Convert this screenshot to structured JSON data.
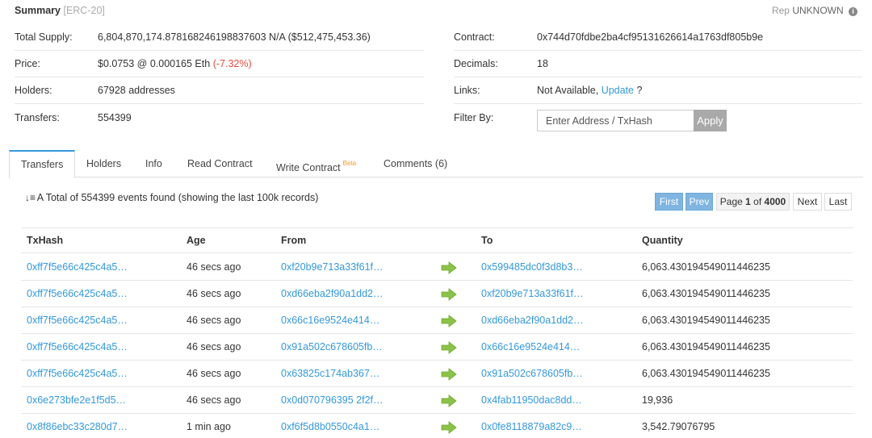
{
  "summary": {
    "title": "Summary",
    "tag": "[ERC-20]",
    "rep_label": "Rep",
    "rep_value": "UNKNOWN",
    "total_supply_label": "Total Supply:",
    "total_supply_value": "6,804,870,174.878168246198837603 N/A ($512,475,453.36)",
    "price_label": "Price:",
    "price_value": "$0.0753 @ 0.000165 Eth",
    "price_change": "(-7.32%)",
    "holders_label": "Holders:",
    "holders_value": "67928 addresses",
    "transfers_label": "Transfers:",
    "transfers_value": "554399",
    "contract_label": "Contract:",
    "contract_value": "0x744d70fdbe2ba4cf95131626614a1763df805b9e",
    "decimals_label": "Decimals:",
    "decimals_value": "18",
    "links_label": "Links:",
    "links_value": "Not Available,",
    "links_update": "Update",
    "links_q": "?",
    "filter_label": "Filter By:",
    "filter_placeholder": "Enter Address / TxHash",
    "apply_label": "Apply"
  },
  "tabs": [
    {
      "label": "Transfers",
      "active": true
    },
    {
      "label": "Holders"
    },
    {
      "label": "Info"
    },
    {
      "label": "Read Contract"
    },
    {
      "label": "Write Contract",
      "badge": "Beta"
    },
    {
      "label": "Comments (6)"
    }
  ],
  "events_text": "A Total of 554399 events found (showing the last 100k records)",
  "pagination": {
    "first": "First",
    "prev": "Prev",
    "page_prefix": "Page",
    "page_current": "1",
    "page_of": "of",
    "page_total": "4000",
    "next": "Next",
    "last": "Last"
  },
  "table": {
    "columns": [
      "TxHash",
      "Age",
      "From",
      "To",
      "Quantity"
    ],
    "rows": [
      {
        "hash": "0xff7f5e66c425c4a5…",
        "age": "46 secs ago",
        "from": "0xf20b9e713a33f61f…",
        "to": "0x599485dc0f3d8b3…",
        "qty": "6,063.430194549011446235"
      },
      {
        "hash": "0xff7f5e66c425c4a5…",
        "age": "46 secs ago",
        "from": "0xd66eba2f90a1dd2…",
        "to": "0xf20b9e713a33f61f…",
        "qty": "6,063.430194549011446235"
      },
      {
        "hash": "0xff7f5e66c425c4a5…",
        "age": "46 secs ago",
        "from": "0x66c16e9524e414…",
        "to": "0xd66eba2f90a1dd2…",
        "qty": "6,063.430194549011446235"
      },
      {
        "hash": "0xff7f5e66c425c4a5…",
        "age": "46 secs ago",
        "from": "0x91a502c678605fb…",
        "to": "0x66c16e9524e414…",
        "qty": "6,063.430194549011446235"
      },
      {
        "hash": "0xff7f5e66c425c4a5…",
        "age": "46 secs ago",
        "from": "0x63825c174ab367…",
        "to": "0x91a502c678605fb…",
        "qty": "6,063.430194549011446235"
      },
      {
        "hash": "0x6e273bfe2e1f5d5…",
        "age": "46 secs ago",
        "from": "0x0d070796395 2f2f…",
        "to": "0x4fab11950dac8dd…",
        "qty": "19,936"
      },
      {
        "hash": "0x8f86ebc33c280d7…",
        "age": "1 min ago",
        "from": "0xf6f5d8b0550c4a1…",
        "to": "0x0fe8118879a82c9…",
        "qty": "3,542.79076795"
      }
    ]
  },
  "colors": {
    "link": "#3498db",
    "negative": "#e74c3c",
    "arrow": "#8bc34a",
    "beta": "#f39c12"
  },
  "icons": {
    "rep_info": "info-circle-icon",
    "sort": "sort-amount-icon",
    "transfer_arrow": "arrow-right-icon"
  }
}
